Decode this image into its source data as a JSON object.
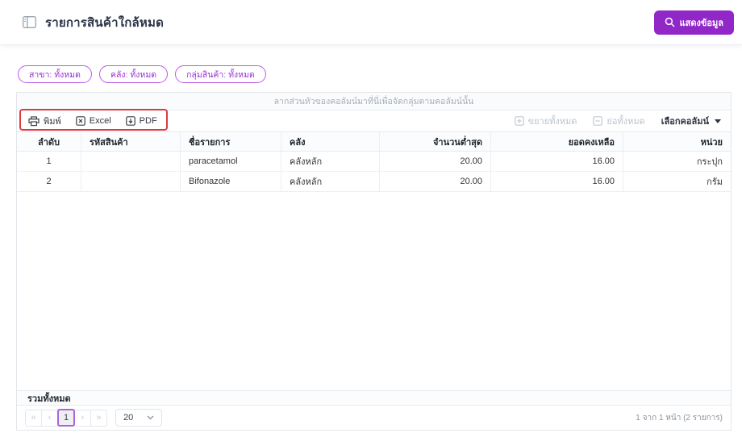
{
  "header": {
    "title": "รายการสินค้าใกล้หมด",
    "show_data_button": "แสดงข้อมูล"
  },
  "filters": {
    "chips": [
      "สาขา: ทั้งหมด",
      "คลัง: ทั้งหมด",
      "กลุ่มสินค้า: ทั้งหมด"
    ]
  },
  "grid": {
    "group_hint": "ลากส่วนหัวของคอลัมน์มาที่นี่เพื่อจัดกลุ่มตามคอลัมน์นั้น",
    "toolbar": {
      "print": "พิมพ์",
      "excel": "Excel",
      "pdf": "PDF",
      "expand_all": "ขยายทั้งหมด",
      "collapse_all": "ย่อทั้งหมด",
      "choose_columns": "เลือกคอลัมน์"
    },
    "columns": [
      "ลำดับ",
      "รหัสสินค้า",
      "ชื่อรายการ",
      "คลัง",
      "จำนวนต่ำสุด",
      "ยอดคงเหลือ",
      "หน่วย"
    ],
    "rows": [
      {
        "index": "1",
        "code": "",
        "name": "paracetamol",
        "warehouse": "คลังหลัก",
        "min_qty": "20.00",
        "balance": "16.00",
        "unit": "กระปุก"
      },
      {
        "index": "2",
        "code": "",
        "name": "Bifonazole",
        "warehouse": "คลังหลัก",
        "min_qty": "20.00",
        "balance": "16.00",
        "unit": "กรัม"
      }
    ],
    "footer_label": "รวมทั้งหมด"
  },
  "pager": {
    "first": "«",
    "prev": "‹",
    "current_page": "1",
    "next": "›",
    "last": "»",
    "page_size": "20",
    "info": "1 จาก 1 หน้า (2 รายการ)"
  },
  "icons": {
    "search-icon": "magnifier",
    "sidebar-panel-icon": "split-panel",
    "printer-icon": "printer",
    "excel-file-icon": "boxed-x",
    "pdf-file-icon": "boxed-arrow",
    "expand-all-icon": "boxed-plus",
    "collapse-all-icon": "boxed-minus",
    "caret-down-icon": "triangle-down",
    "chevron-down-icon": "chevron-down"
  },
  "colors": {
    "accent_purple": "#9127c7",
    "chip_purple": "#9a30d2",
    "annotation_red": "#dc3b42",
    "title_text": "#2a3547"
  }
}
